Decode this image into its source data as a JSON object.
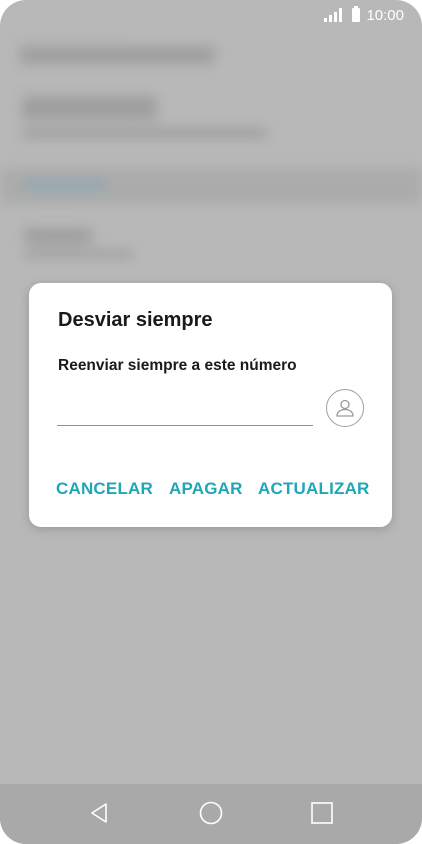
{
  "status_bar": {
    "time": "10:00",
    "icons": [
      "signal-icon",
      "battery-icon"
    ]
  },
  "dialog": {
    "title": "Desviar siempre",
    "label": "Reenviar siempre a este número",
    "number_input": {
      "value": "",
      "placeholder": ""
    },
    "contact_icon": "contact-person-icon",
    "actions": {
      "cancel": "CANCELAR",
      "turn_off": "APAGAR",
      "update": "ACTUALIZAR"
    }
  },
  "navigation": {
    "buttons": [
      "back-icon",
      "home-icon",
      "recents-icon"
    ]
  },
  "colors": {
    "accent": "#1fa6b8",
    "input_underline": "#3ab0c4",
    "scrim": "#b8b8b8",
    "nav_bar": "#a9a9a9"
  }
}
